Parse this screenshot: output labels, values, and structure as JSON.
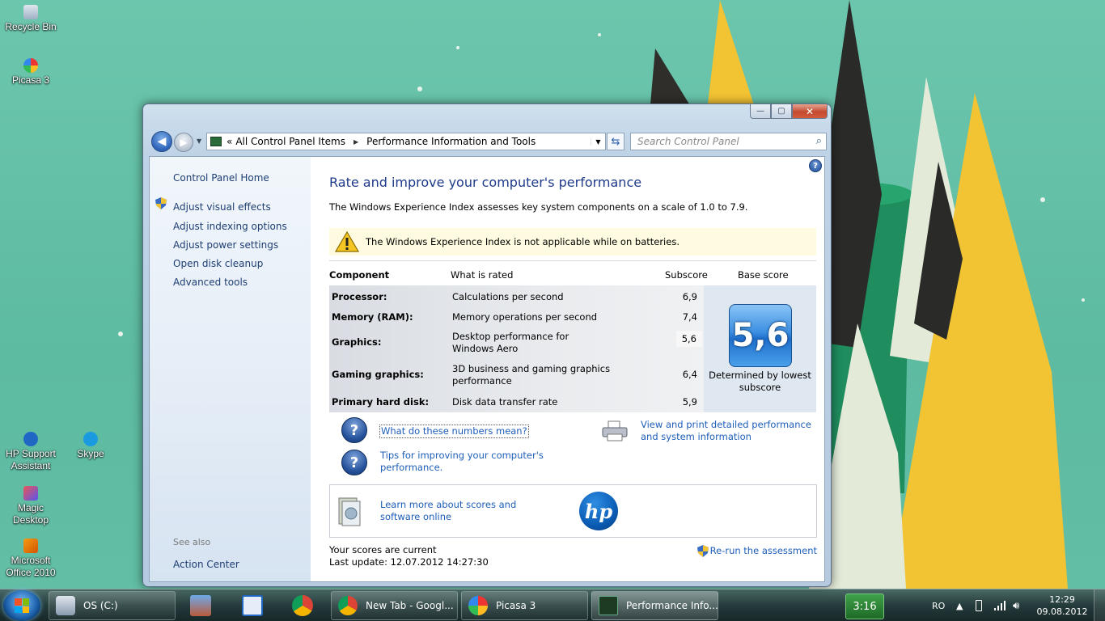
{
  "desktop": {
    "icons": [
      {
        "label": "Recycle Bin"
      },
      {
        "label": "Picasa 3"
      },
      {
        "label": "HP Support Assistant"
      },
      {
        "label": "Skype"
      },
      {
        "label": "Magic Desktop"
      },
      {
        "label": "Microsoft Office 2010"
      }
    ]
  },
  "window": {
    "nav": {
      "address_prefix": "«",
      "crumbs": [
        "All Control Panel Items",
        "Performance Information and Tools"
      ],
      "search_placeholder": "Search Control Panel"
    },
    "leftpane": {
      "home": "Control Panel Home",
      "links": [
        "Adjust visual effects",
        "Adjust indexing options",
        "Adjust power settings",
        "Open disk cleanup",
        "Advanced tools"
      ],
      "see_also": "See also",
      "action_center": "Action Center"
    },
    "main": {
      "title": "Rate and improve your computer's performance",
      "description": "The Windows Experience Index assesses key system components on a scale of 1.0 to 7.9.",
      "warning": "The Windows Experience Index is not applicable while on batteries.",
      "columns": [
        "Component",
        "What is rated",
        "Subscore",
        "Base score"
      ],
      "rows": [
        {
          "component": "Processor:",
          "rated": "Calculations per second",
          "subscore": "6,9"
        },
        {
          "component": "Memory (RAM):",
          "rated": "Memory operations per second",
          "subscore": "7,4"
        },
        {
          "component": "Graphics:",
          "rated": "Desktop performance for Windows Aero",
          "subscore": "5,6"
        },
        {
          "component": "Gaming graphics:",
          "rated": "3D business and gaming graphics performance",
          "subscore": "6,4"
        },
        {
          "component": "Primary hard disk:",
          "rated": "Disk data transfer rate",
          "subscore": "5,9"
        }
      ],
      "base_score": "5,6",
      "base_caption": "Determined by lowest subscore",
      "link_numbers": "What do these numbers mean?",
      "link_tips": "Tips for improving your computer's performance.",
      "link_print": "View and print detailed performance and system information",
      "link_learn": "Learn more about scores and software online",
      "hp_logo_text": "hp",
      "status": "Your scores are current",
      "last_update": "Last update: 12.07.2012 14:27:30",
      "rerun": "Re-run the assessment"
    }
  },
  "taskbar": {
    "items": [
      {
        "label": "OS (C:)"
      },
      {
        "label": "New Tab - Googl..."
      },
      {
        "label": "Picasa 3"
      },
      {
        "label": "Performance Info..."
      }
    ],
    "gadget_time": "3:16",
    "language": "RO",
    "clock_time": "12:29",
    "clock_date": "09.08.2012"
  },
  "colors": {
    "accent_link": "#1e5eb8",
    "heading": "#1e3a8a",
    "wallpaper": "#5fbfa6"
  }
}
